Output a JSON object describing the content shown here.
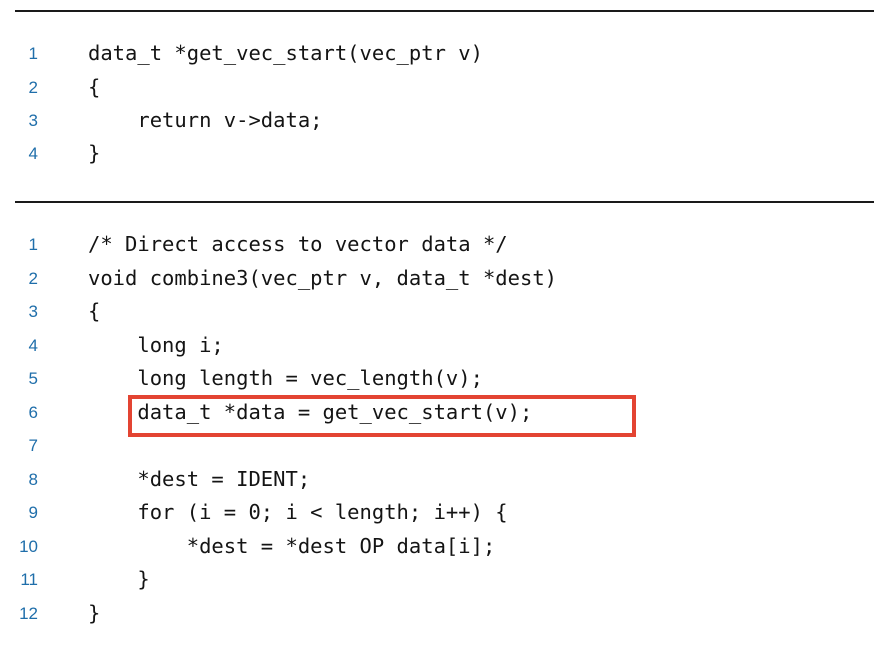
{
  "listing_a": {
    "lines": [
      {
        "num": "1",
        "code": "data_t *get_vec_start(vec_ptr v)"
      },
      {
        "num": "2",
        "code": "{"
      },
      {
        "num": "3",
        "code": "    return v->data;"
      },
      {
        "num": "4",
        "code": "}"
      }
    ]
  },
  "listing_b": {
    "lines": [
      {
        "num": "1",
        "code": "/* Direct access to vector data */"
      },
      {
        "num": "2",
        "code": "void combine3(vec_ptr v, data_t *dest)"
      },
      {
        "num": "3",
        "code": "{"
      },
      {
        "num": "4",
        "code": "    long i;"
      },
      {
        "num": "5",
        "code": "    long length = vec_length(v);"
      },
      {
        "num": "6",
        "code": "    data_t *data = get_vec_start(v);"
      },
      {
        "num": "7",
        "code": ""
      },
      {
        "num": "8",
        "code": "    *dest = IDENT;"
      },
      {
        "num": "9",
        "code": "    for (i = 0; i < length; i++) {"
      },
      {
        "num": "10",
        "code": "        *dest = *dest OP data[i];"
      },
      {
        "num": "11",
        "code": "    }"
      },
      {
        "num": "12",
        "code": "}"
      }
    ]
  },
  "highlight": {
    "color": "#e34432",
    "target_line": "6"
  },
  "colors": {
    "line_number": "#1f6eaa",
    "code_text": "#141414",
    "rule": "#1a1a1a"
  }
}
